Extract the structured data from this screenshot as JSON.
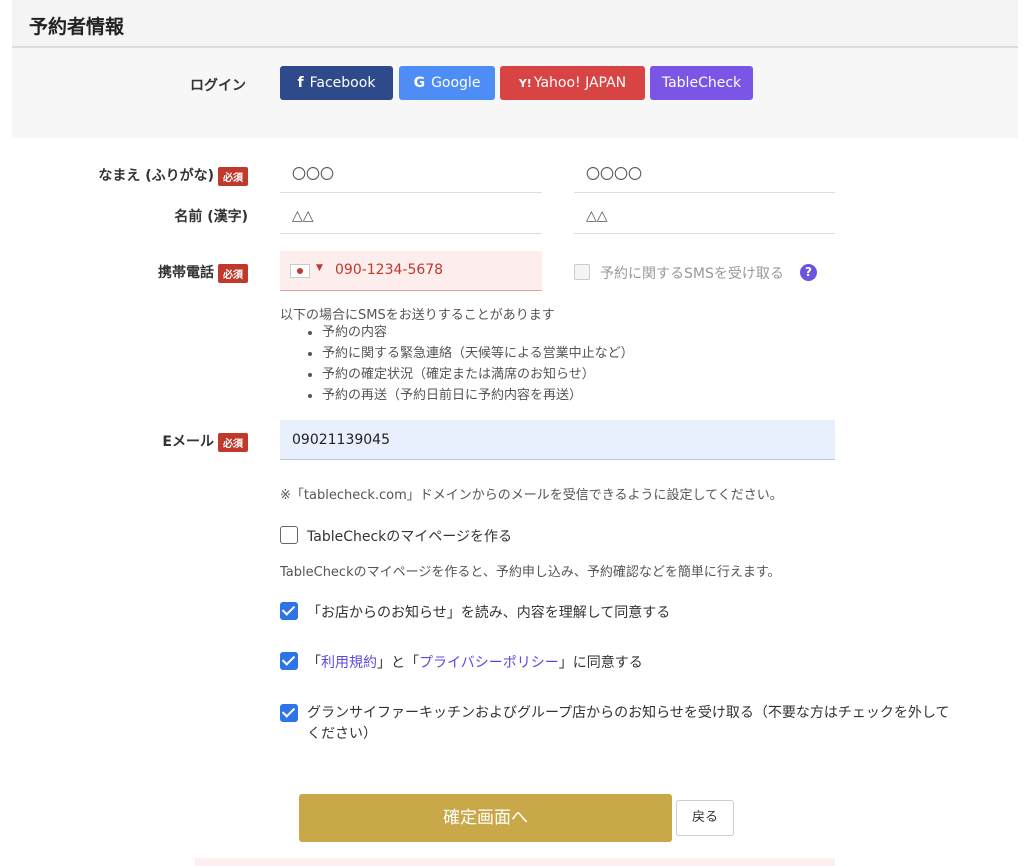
{
  "header": {
    "title": "予約者情報"
  },
  "login": {
    "label": "ログイン",
    "buttons": [
      {
        "icon": "f",
        "label": "Facebook",
        "color": "#2f4a8a"
      },
      {
        "icon": "G",
        "label": "Google",
        "color": "#4e8df5"
      },
      {
        "icon": "Y!",
        "label": "Yahoo! JAPAN",
        "color": "#d84343"
      },
      {
        "label": "TableCheck",
        "color": "#7a55e6"
      }
    ]
  },
  "name_kana": {
    "label": "なまえ (ふりがな)",
    "required": "必須",
    "first": "〇〇〇",
    "last": "〇〇〇〇"
  },
  "name_kanji": {
    "label": "名前 (漢字)",
    "first": "△△",
    "last": "△△"
  },
  "phone": {
    "label": "携帯電話",
    "required": "必須",
    "value": "090-1234-5678",
    "sms_label": "予約に関するSMSを受け取る",
    "help": "?",
    "note": "以下の場合にSMSをお送りすることがあります",
    "items": [
      "予約の内容",
      "予約に関する緊急連絡（天候等による営業中止など）",
      "予約の確定状況（確定または満席のお知らせ）",
      "予約の再送（予約日前日に予約内容を再送）"
    ]
  },
  "email": {
    "label": "Eメール",
    "required": "必須",
    "value": "09021139045",
    "note": "※「tablecheck.com」ドメインからのメールを受信できるように設定してください。"
  },
  "mypage": {
    "label": "TableCheckのマイページを作る",
    "note": "TableCheckのマイページを作ると、予約申し込み、予約確認などを簡単に行えます。"
  },
  "agree_notice": "「お店からのお知らせ」を読み、内容を理解して同意する",
  "agree_terms": {
    "pre": "「",
    "terms": "利用規約",
    "mid": "」と「",
    "privacy": "プライバシーポリシー",
    "post": "」に同意する"
  },
  "agree_newsletter": {
    "line1": "グランサイファーキッチンおよびグループ店からのお知らせを受け取る（不要な方はチェックを外して",
    "line2": "ください）"
  },
  "actions": {
    "confirm": "確定画面へ",
    "back": "戻る"
  }
}
